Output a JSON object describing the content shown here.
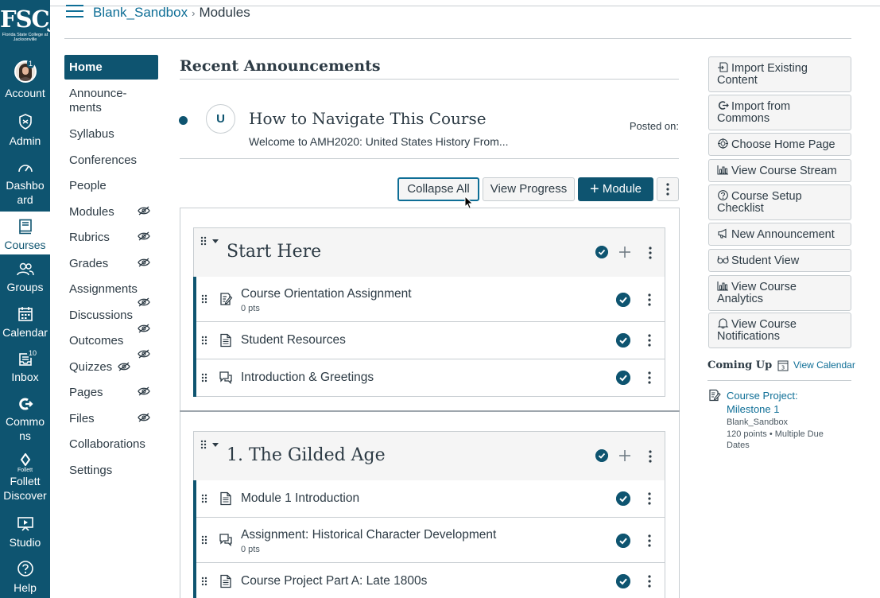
{
  "brand": {
    "logo_text": "FSCJ",
    "logo_subtext": "Florida State College at Jacksonville",
    "accent": "#0e5470",
    "link": "#0e6e96"
  },
  "global_nav": {
    "account": {
      "label": "Account",
      "badge": "1",
      "icon": "avatar"
    },
    "admin": {
      "label": "Admin",
      "icon": "shield-icon"
    },
    "dashboard": {
      "label": "Dashboard",
      "icon": "speedometer-icon"
    },
    "courses": {
      "label": "Courses",
      "icon": "book-icon"
    },
    "groups": {
      "label": "Groups",
      "icon": "people-icon"
    },
    "calendar": {
      "label": "Calendar",
      "icon": "calendar-icon"
    },
    "inbox": {
      "label": "Inbox",
      "badge": "10",
      "icon": "inbox-icon"
    },
    "commons": {
      "label": "Commons",
      "icon": "commons-icon"
    },
    "follett": {
      "label": "Follett Discover",
      "small": "Follett",
      "icon": "follett-icon"
    },
    "studio": {
      "label": "Studio",
      "icon": "studio-icon"
    },
    "help": {
      "label": "Help",
      "icon": "help-icon"
    }
  },
  "breadcrumb": {
    "course": "Blank_Sandbox",
    "separator": "›",
    "page": "Modules"
  },
  "course_nav": {
    "items": [
      {
        "label": "Home"
      },
      {
        "label": "Announce-ments"
      },
      {
        "label": "Syllabus"
      },
      {
        "label": "Conferences"
      },
      {
        "label": "People"
      },
      {
        "label": "Modules"
      },
      {
        "label": "Rubrics"
      },
      {
        "label": "Grades"
      },
      {
        "label": "Assignments"
      },
      {
        "label": "Discussions"
      },
      {
        "label": "Outcomes"
      },
      {
        "label": "Quizzes"
      },
      {
        "label": "Pages"
      },
      {
        "label": "Files"
      },
      {
        "label": "Collaborations"
      },
      {
        "label": "Settings"
      }
    ]
  },
  "announcements": {
    "title": "Recent Announcements",
    "item": {
      "avatar": "U",
      "title": "How to Navigate This Course",
      "desc": "Welcome to AMH2020: United States History From...",
      "posted": "Posted on:"
    }
  },
  "toolbar": {
    "collapse": "Collapse All",
    "progress": "View Progress",
    "add_module": "Module",
    "add_symbol": "+"
  },
  "modules": [
    {
      "title": "Start Here",
      "items": [
        {
          "title": "Course Orientation Assignment",
          "sub": "0 pts",
          "icon": "assignment-icon"
        },
        {
          "title": "Student Resources",
          "icon": "page-icon"
        },
        {
          "title": "Introduction & Greetings",
          "icon": "discussion-icon"
        }
      ]
    },
    {
      "title": "1. The Gilded Age",
      "items": [
        {
          "title": "Module 1 Introduction",
          "icon": "page-icon"
        },
        {
          "title": "Assignment: Historical Character Development",
          "sub": "0 pts",
          "icon": "discussion-icon"
        },
        {
          "title": "Course Project Part A: Late 1800s",
          "icon": "page-icon"
        }
      ]
    }
  ],
  "sidebar": {
    "buttons": [
      {
        "label": "Import Existing Content",
        "icon": "import-icon"
      },
      {
        "label": "Import from Commons",
        "icon": "commons-icon"
      },
      {
        "label": "Choose Home Page",
        "icon": "target-icon"
      },
      {
        "label": "View Course Stream",
        "icon": "analytics-icon"
      },
      {
        "label": "Course Setup Checklist",
        "icon": "question-icon"
      },
      {
        "label": "New Announcement",
        "icon": "megaphone-icon"
      },
      {
        "label": "Student View",
        "icon": "glasses-icon"
      },
      {
        "label": "View Course Analytics",
        "icon": "analytics-icon"
      },
      {
        "label": "View Course Notifications",
        "icon": "bell-icon"
      }
    ],
    "coming_up": {
      "title": "Coming Up",
      "view_calendar": "View Calendar",
      "calendar_day": "3",
      "item": {
        "title": "Course Project: Milestone 1",
        "course": "Blank_Sandbox",
        "meta": "120 points • Multiple Due Dates"
      }
    }
  }
}
